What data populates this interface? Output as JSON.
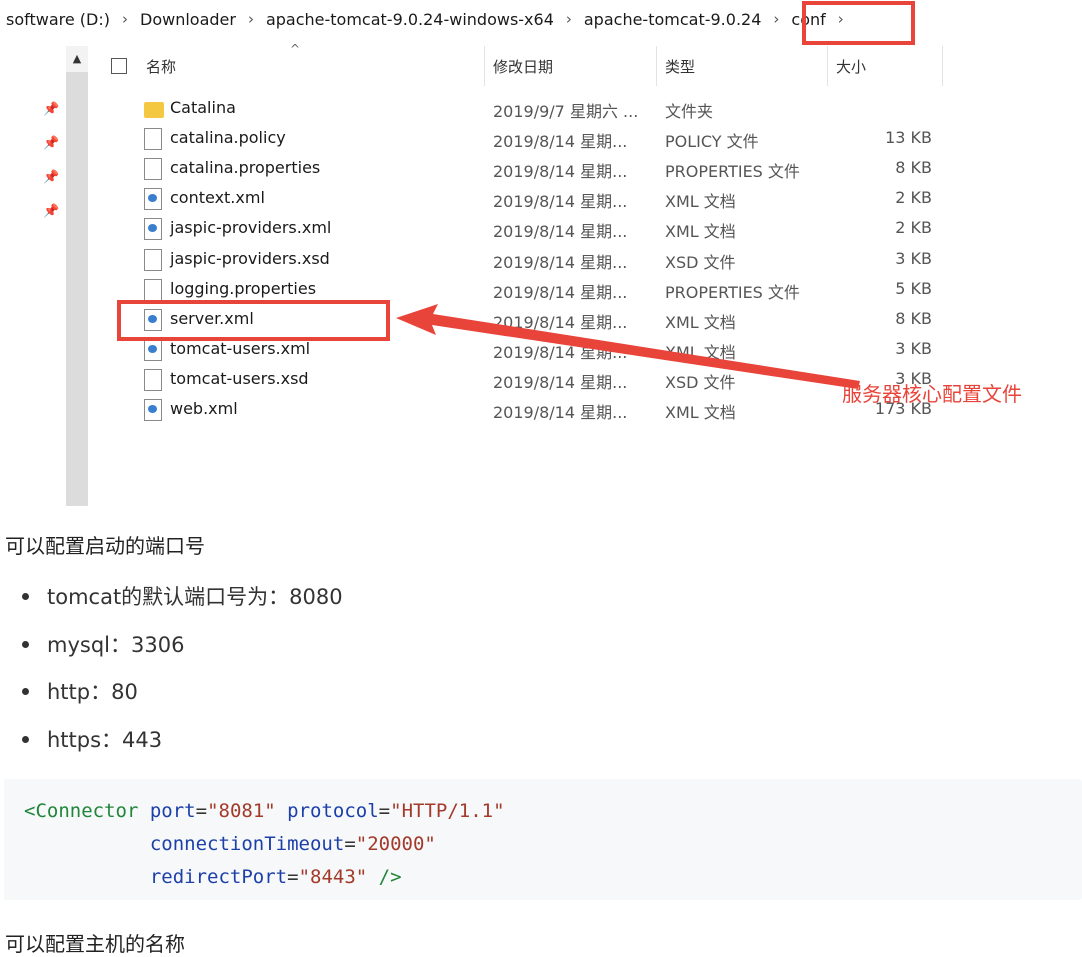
{
  "breadcrumb": [
    "software (D:)",
    "Downloader",
    "apache-tomcat-9.0.24-windows-x64",
    "apache-tomcat-9.0.24",
    "conf"
  ],
  "breadcrumb_sep": "›",
  "columns": {
    "name": "名称",
    "date": "修改日期",
    "type": "类型",
    "size": "大小"
  },
  "files": [
    {
      "name": "Catalina",
      "date": "2019/9/7 星期六 ...",
      "type": "文件夹",
      "size": "",
      "icon": "folder-icon"
    },
    {
      "name": "catalina.policy",
      "date": "2019/8/14 星期...",
      "type": "POLICY 文件",
      "size": "13 KB",
      "icon": "file-icon"
    },
    {
      "name": "catalina.properties",
      "date": "2019/8/14 星期...",
      "type": "PROPERTIES 文件",
      "size": "8 KB",
      "icon": "file-icon"
    },
    {
      "name": "context.xml",
      "date": "2019/8/14 星期...",
      "type": "XML 文档",
      "size": "2 KB",
      "icon": "xml-file-icon"
    },
    {
      "name": "jaspic-providers.xml",
      "date": "2019/8/14 星期...",
      "type": "XML 文档",
      "size": "2 KB",
      "icon": "xml-file-icon"
    },
    {
      "name": "jaspic-providers.xsd",
      "date": "2019/8/14 星期...",
      "type": "XSD 文件",
      "size": "3 KB",
      "icon": "file-icon"
    },
    {
      "name": "logging.properties",
      "date": "2019/8/14 星期...",
      "type": "PROPERTIES 文件",
      "size": "5 KB",
      "icon": "file-icon"
    },
    {
      "name": "server.xml",
      "date": "2019/8/14 星期...",
      "type": "XML 文档",
      "size": "8 KB",
      "icon": "xml-file-icon"
    },
    {
      "name": "tomcat-users.xml",
      "date": "2019/8/14 星期...",
      "type": "XML 文档",
      "size": "3 KB",
      "icon": "xml-file-icon"
    },
    {
      "name": "tomcat-users.xsd",
      "date": "2019/8/14 星期...",
      "type": "XSD 文件",
      "size": "3 KB",
      "icon": "file-icon"
    },
    {
      "name": "web.xml",
      "date": "2019/8/14 星期...",
      "type": "XML 文档",
      "size": "173 KB",
      "icon": "xml-file-icon"
    }
  ],
  "annotation": "服务器核心配置文件",
  "doc": {
    "para1": "可以配置启动的端口号",
    "list": [
      "tomcat的默认端口号为：8080",
      "mysql：3306",
      "http：80",
      "https：443"
    ],
    "code": {
      "tag": "<Connector",
      "attrs": [
        {
          "name": "port",
          "value": "\"8081\""
        },
        {
          "name": "protocol",
          "value": "\"HTTP/1.1\""
        },
        {
          "name": "connectionTimeout",
          "value": "\"20000\""
        },
        {
          "name": "redirectPort",
          "value": "\"8443\""
        }
      ],
      "close": " />"
    },
    "para2": "可以配置主机的名称"
  },
  "colors": {
    "highlight": "#e8443a",
    "folder": "#f5c842"
  }
}
